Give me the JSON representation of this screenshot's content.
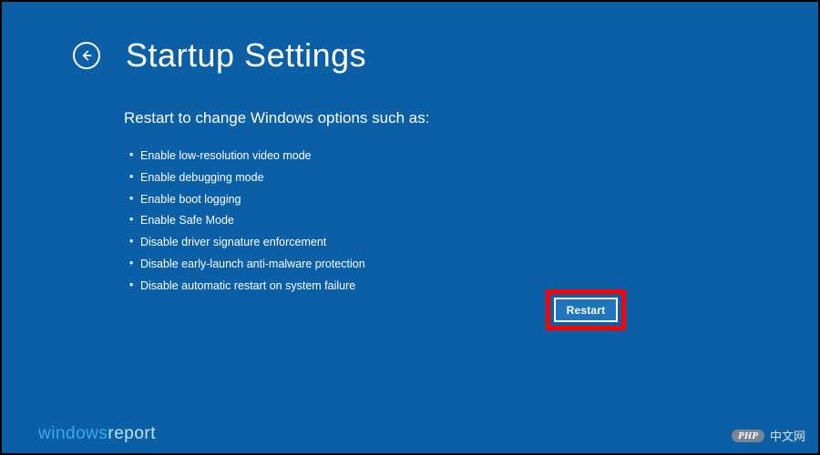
{
  "header": {
    "back_icon": "back-arrow-icon",
    "title": "Startup Settings"
  },
  "content": {
    "subtitle": "Restart to change Windows options such as:",
    "options": [
      "Enable low-resolution video mode",
      "Enable debugging mode",
      "Enable boot logging",
      "Enable Safe Mode",
      "Disable driver signature enforcement",
      "Disable early-launch anti-malware protection",
      "Disable automatic restart on system failure"
    ]
  },
  "actions": {
    "restart_label": "Restart"
  },
  "watermarks": {
    "left_a": "windows",
    "left_b": "report",
    "right_badge": "PHP",
    "right_text": "中文网"
  },
  "colors": {
    "background": "#0a5fa6",
    "highlight_border": "#ff0000",
    "button_bg": "#1f76bf"
  }
}
